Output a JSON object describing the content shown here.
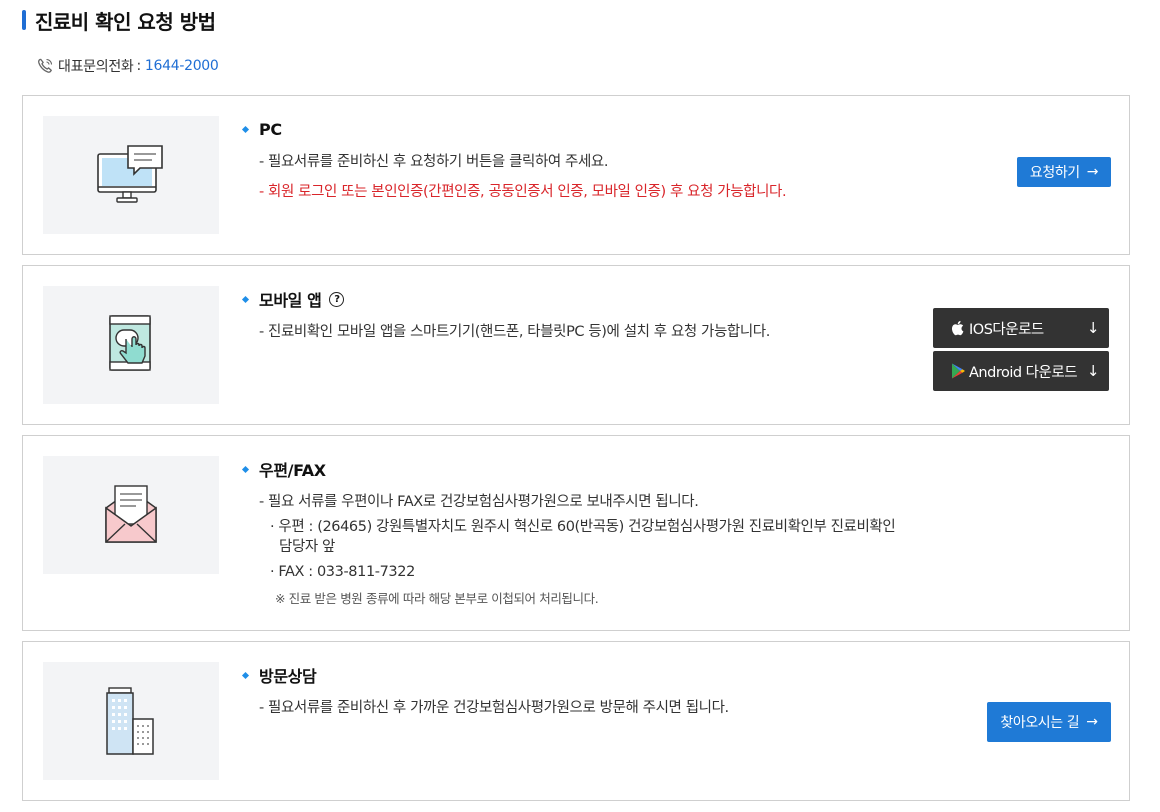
{
  "page": {
    "title": "진료비 확인 요청 방법",
    "phone_label": "대표문의전화",
    "phone_colon": ":",
    "phone_number": "1644-2000"
  },
  "pc": {
    "heading": "PC",
    "line1": "- 필요서류를 준비하신 후 요청하기 버튼을 클릭하여 주세요.",
    "line2": "- 회원 로그인 또는 본인인증(간편인증, 공동인증서 인증, 모바일 인증) 후 요청 가능합니다.",
    "button_label": "요청하기",
    "button_arrow": "→"
  },
  "mobile": {
    "heading": "모바일 앱",
    "help": "?",
    "line1": "- 진료비확인 모바일 앱을 스마트기기(핸드폰, 타블릿PC 등)에 설치 후 요청 가능합니다.",
    "ios_label": "IOS다운로드",
    "android_label": "Android 다운로드",
    "download_arrow": "↓"
  },
  "mail": {
    "heading": "우편/FAX",
    "line1": "- 필요 서류를 우편이나 FAX로 건강보험심사평가원으로 보내주시면 됩니다.",
    "address_line1": "· 우편 : (26465) 강원특별자치도 원주시 혁신로 60(반곡동) 건강보험심사평가원 진료비확인부 진료비확인",
    "address_line2": "담당자 앞",
    "fax_line": "· FAX : 033-811-7322",
    "note": "※ 진료 받은 병원 종류에 따라 해당 본부로 이첩되어 처리됩니다."
  },
  "visit": {
    "heading": "방문상담",
    "line1": "- 필요서류를 준비하신 후 가까운 건강보험심사평가원으로 방문해 주시면 됩니다.",
    "button_label": "찾아오시는 길",
    "button_arrow": "→"
  },
  "colors": {
    "accent": "#1f7ad6",
    "warning": "#d9252a",
    "dark_button": "#333333",
    "thumb_bg": "#f3f4f6"
  },
  "icons": [
    "phone-icon",
    "monitor-chat-icon",
    "tablet-touch-icon",
    "envelope-icon",
    "building-icon",
    "apple-icon",
    "play-store-icon",
    "help-icon"
  ]
}
